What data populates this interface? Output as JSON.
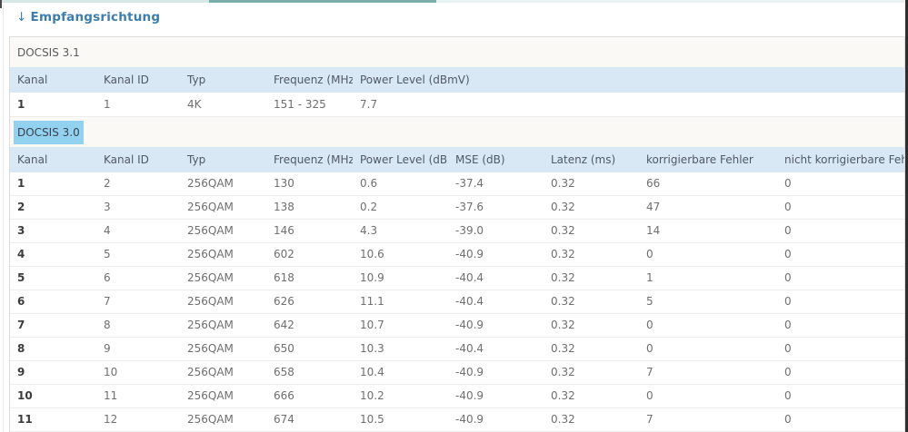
{
  "header": {
    "collapse_arrow": "↓",
    "title": "Empfangsrichtung"
  },
  "tables": {
    "docsis31": {
      "caption": "DOCSIS 3.1",
      "columns": [
        "Kanal",
        "Kanal ID",
        "Typ",
        "Frequenz (MHz)",
        "Power Level (dBmV)"
      ],
      "rows": [
        [
          "1",
          "1",
          "4K",
          "151 - 325",
          "7.7"
        ]
      ]
    },
    "docsis30": {
      "caption": "DOCSIS 3.0",
      "columns": [
        "Kanal",
        "Kanal ID",
        "Typ",
        "Frequenz (MHz)",
        "Power Level (dBmV)",
        "MSE (dB)",
        "Latenz (ms)",
        "korrigierbare Fehler",
        "nicht korrigierbare Fehler"
      ],
      "rows": [
        [
          "1",
          "2",
          "256QAM",
          "130",
          "0.6",
          "-37.4",
          "0.32",
          "66",
          "0"
        ],
        [
          "2",
          "3",
          "256QAM",
          "138",
          "0.2",
          "-37.6",
          "0.32",
          "47",
          "0"
        ],
        [
          "3",
          "4",
          "256QAM",
          "146",
          "4.3",
          "-39.0",
          "0.32",
          "14",
          "0"
        ],
        [
          "4",
          "5",
          "256QAM",
          "602",
          "10.6",
          "-40.9",
          "0.32",
          "0",
          "0"
        ],
        [
          "5",
          "6",
          "256QAM",
          "618",
          "10.9",
          "-40.4",
          "0.32",
          "1",
          "0"
        ],
        [
          "6",
          "7",
          "256QAM",
          "626",
          "11.1",
          "-40.4",
          "0.32",
          "5",
          "0"
        ],
        [
          "7",
          "8",
          "256QAM",
          "642",
          "10.7",
          "-40.9",
          "0.32",
          "0",
          "0"
        ],
        [
          "8",
          "9",
          "256QAM",
          "650",
          "10.3",
          "-40.4",
          "0.32",
          "0",
          "0"
        ],
        [
          "9",
          "10",
          "256QAM",
          "658",
          "10.4",
          "-40.9",
          "0.32",
          "7",
          "0"
        ],
        [
          "10",
          "11",
          "256QAM",
          "666",
          "10.2",
          "-40.9",
          "0.32",
          "0",
          "0"
        ],
        [
          "11",
          "12",
          "256QAM",
          "674",
          "10.5",
          "-40.9",
          "0.32",
          "7",
          "0"
        ]
      ]
    }
  },
  "colors": {
    "accent": "#3d7dad",
    "table_header_bg": "#d9e8f5",
    "selection_highlight": "#92d1f0",
    "caption_bg": "#faf9f6",
    "row_border": "#ececec",
    "topbar_teal": "#7aadab"
  }
}
